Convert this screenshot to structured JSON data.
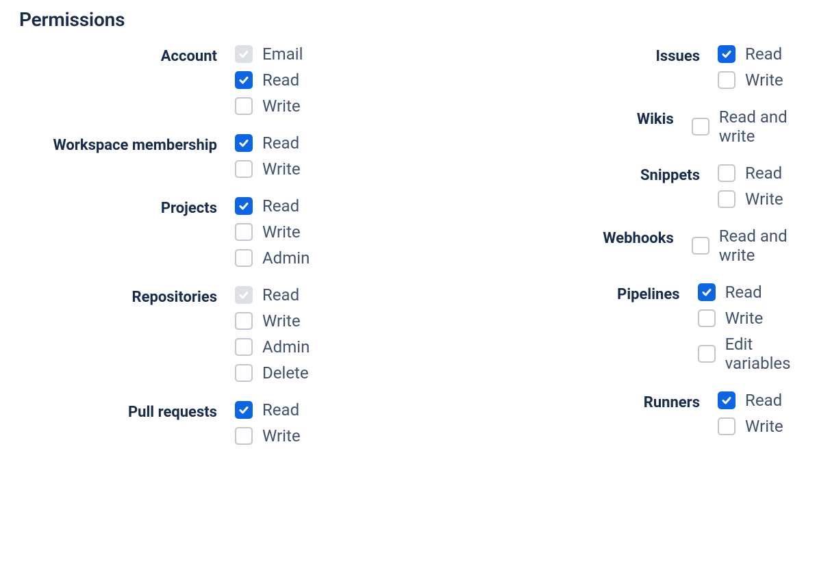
{
  "title": "Permissions",
  "left": [
    {
      "label": "Account",
      "name": "account",
      "options": [
        {
          "label": "Email",
          "name": "email",
          "state": "disabled-checked"
        },
        {
          "label": "Read",
          "name": "read",
          "state": "checked"
        },
        {
          "label": "Write",
          "name": "write",
          "state": "unchecked"
        }
      ]
    },
    {
      "label": "Workspace membership",
      "name": "workspace-membership",
      "options": [
        {
          "label": "Read",
          "name": "read",
          "state": "checked"
        },
        {
          "label": "Write",
          "name": "write",
          "state": "unchecked"
        }
      ]
    },
    {
      "label": "Projects",
      "name": "projects",
      "options": [
        {
          "label": "Read",
          "name": "read",
          "state": "checked"
        },
        {
          "label": "Write",
          "name": "write",
          "state": "unchecked"
        },
        {
          "label": "Admin",
          "name": "admin",
          "state": "unchecked"
        }
      ]
    },
    {
      "label": "Repositories",
      "name": "repositories",
      "options": [
        {
          "label": "Read",
          "name": "read",
          "state": "disabled-checked"
        },
        {
          "label": "Write",
          "name": "write",
          "state": "unchecked"
        },
        {
          "label": "Admin",
          "name": "admin",
          "state": "unchecked"
        },
        {
          "label": "Delete",
          "name": "delete",
          "state": "unchecked"
        }
      ]
    },
    {
      "label": "Pull requests",
      "name": "pull-requests",
      "options": [
        {
          "label": "Read",
          "name": "read",
          "state": "checked"
        },
        {
          "label": "Write",
          "name": "write",
          "state": "unchecked"
        }
      ]
    }
  ],
  "right": [
    {
      "label": "Issues",
      "name": "issues",
      "options": [
        {
          "label": "Read",
          "name": "read",
          "state": "checked"
        },
        {
          "label": "Write",
          "name": "write",
          "state": "unchecked"
        }
      ]
    },
    {
      "label": "Wikis",
      "name": "wikis",
      "options": [
        {
          "label": "Read and write",
          "name": "read-and-write",
          "state": "unchecked"
        }
      ]
    },
    {
      "label": "Snippets",
      "name": "snippets",
      "options": [
        {
          "label": "Read",
          "name": "read",
          "state": "unchecked"
        },
        {
          "label": "Write",
          "name": "write",
          "state": "unchecked"
        }
      ]
    },
    {
      "label": "Webhooks",
      "name": "webhooks",
      "options": [
        {
          "label": "Read and write",
          "name": "read-and-write",
          "state": "unchecked"
        }
      ]
    },
    {
      "label": "Pipelines",
      "name": "pipelines",
      "options": [
        {
          "label": "Read",
          "name": "read",
          "state": "checked"
        },
        {
          "label": "Write",
          "name": "write",
          "state": "unchecked"
        },
        {
          "label": "Edit variables",
          "name": "edit-variables",
          "state": "unchecked"
        }
      ]
    },
    {
      "label": "Runners",
      "name": "runners",
      "options": [
        {
          "label": "Read",
          "name": "read",
          "state": "checked"
        },
        {
          "label": "Write",
          "name": "write",
          "state": "unchecked"
        }
      ]
    }
  ]
}
